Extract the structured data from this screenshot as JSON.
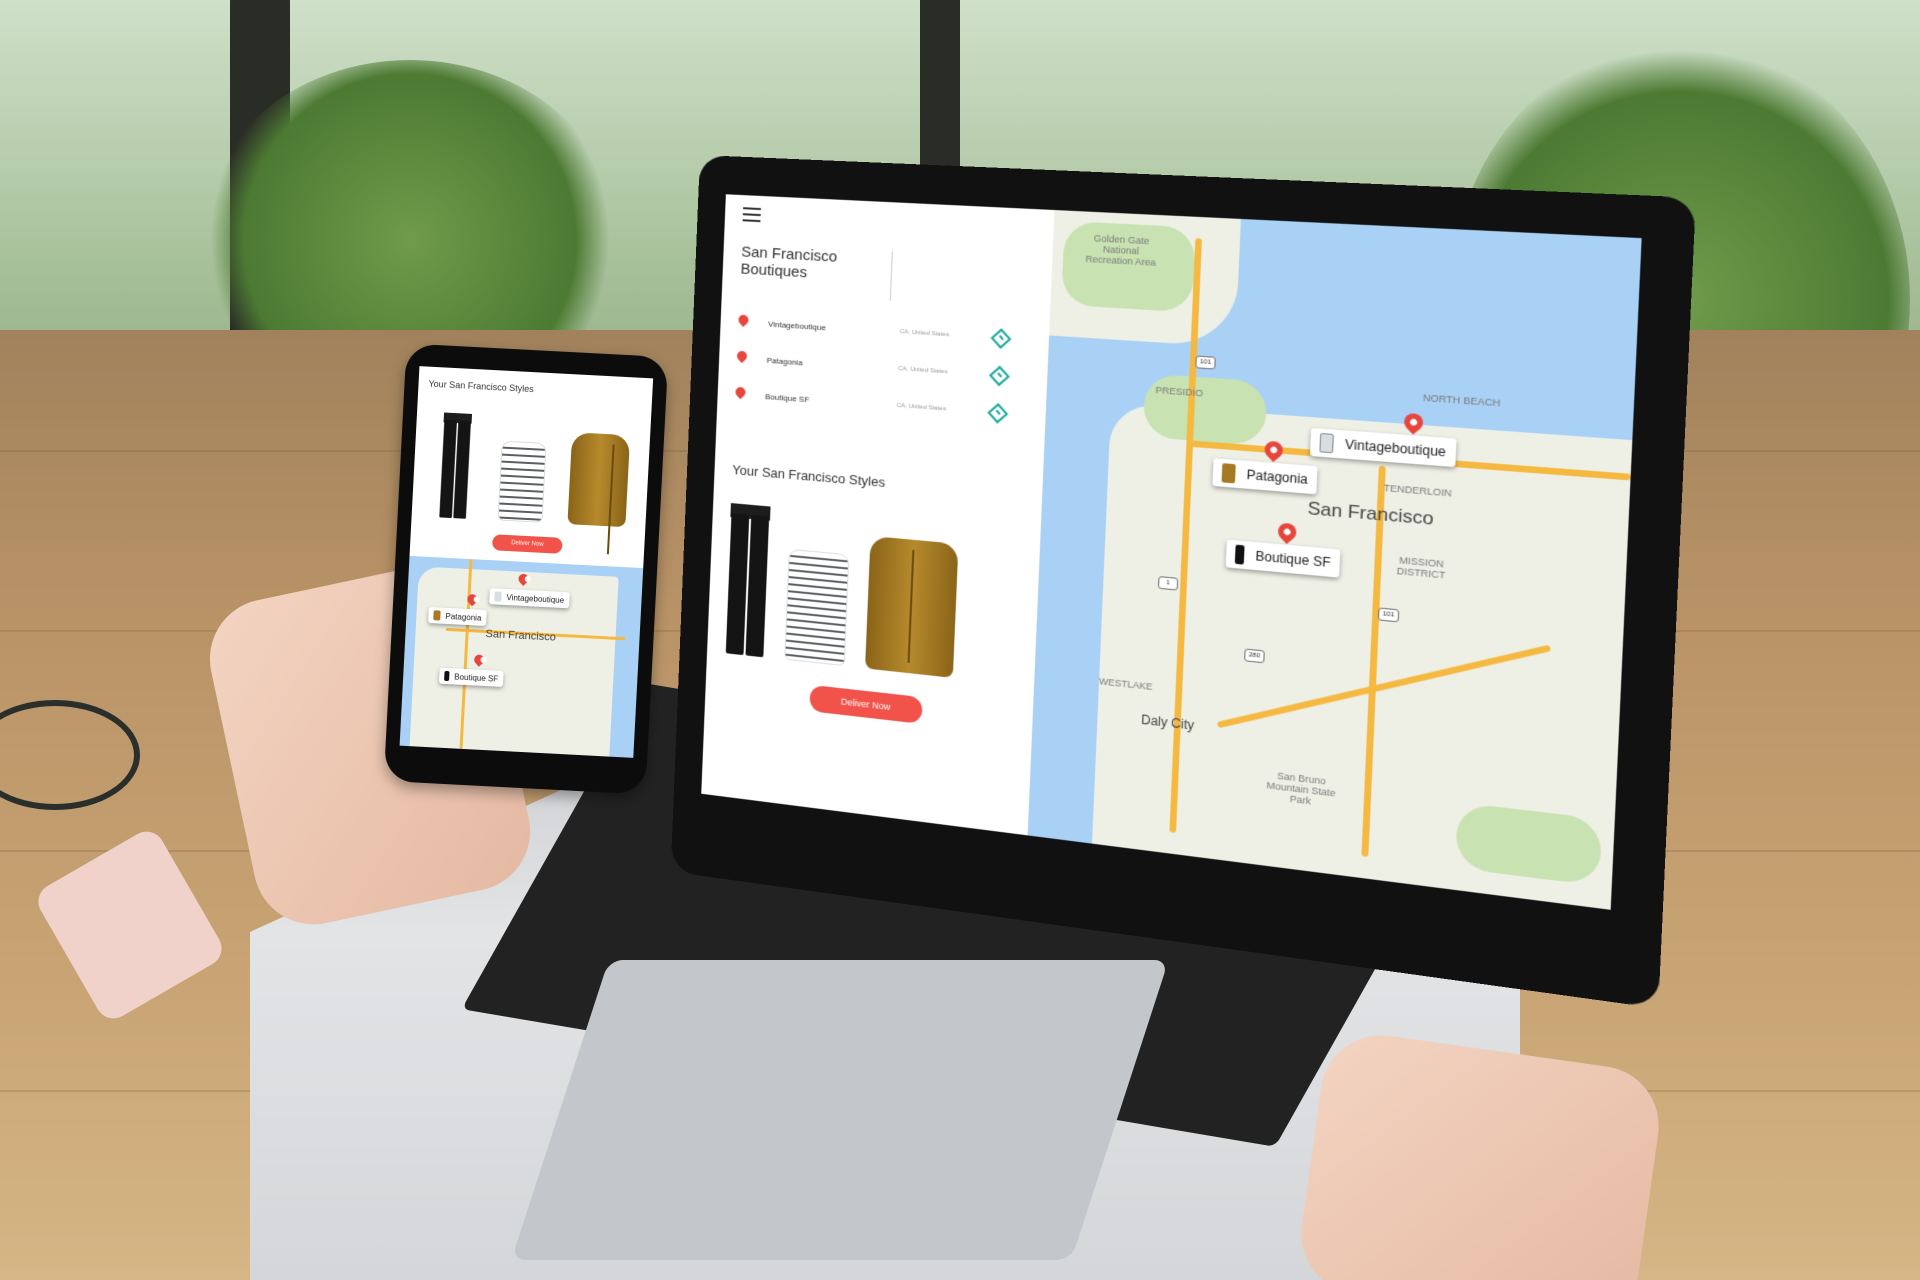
{
  "laptop": {
    "panel_title": "San Francisco Boutiques",
    "shops": [
      {
        "name": "Vintageboutique",
        "location": "CA, United States"
      },
      {
        "name": "Patagonia",
        "location": "CA, United States"
      },
      {
        "name": "Boutique SF",
        "location": "CA, United States"
      }
    ],
    "styles_title": "Your San Francisco Styles",
    "deliver_label": "Deliver Now",
    "map": {
      "city": "San Francisco",
      "golden_gate": "Golden Gate National Recreation Area",
      "presidio": "PRESIDIO",
      "north_beach": "NORTH BEACH",
      "tenderloin": "TENDERLOIN",
      "mission": "MISSION DISTRICT",
      "westlake": "WESTLAKE",
      "daly_city": "Daly City",
      "san_bruno": "San Bruno Mountain State Park",
      "shields": [
        "101",
        "1",
        "101",
        "280"
      ],
      "callouts": [
        "Vintageboutique",
        "Patagonia",
        "Boutique SF"
      ]
    }
  },
  "phone": {
    "styles_title": "Your San Francisco Styles",
    "deliver_label": "Deliver Now",
    "map": {
      "city": "San Francisco",
      "callouts": [
        "Vintageboutique",
        "Patagonia",
        "Boutique SF"
      ]
    }
  },
  "colors": {
    "accent": "#f1524a",
    "pin": "#e8453c",
    "direction": "#1aa99a",
    "water": "#a9d0f5",
    "road": "#f5b942"
  }
}
